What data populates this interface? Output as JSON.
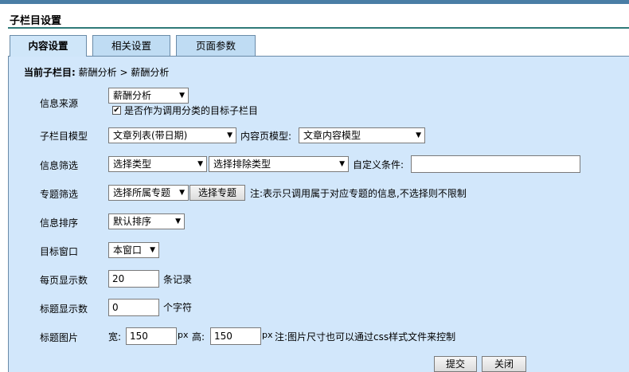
{
  "page": {
    "title": "子栏目设置"
  },
  "tabs": [
    {
      "label": "内容设置",
      "active": true
    },
    {
      "label": "相关设置",
      "active": false
    },
    {
      "label": "页面参数",
      "active": false
    }
  ],
  "breadcrumb": {
    "prefix": "当前子栏目:",
    "path": "薪酬分析 > 薪酬分析"
  },
  "form": {
    "source": {
      "label": "信息来源",
      "value": "薪酬分析",
      "checkbox_checked": true,
      "checkbox_label": "是否作为调用分类的目标子栏目"
    },
    "model": {
      "label": "子栏目模型",
      "value": "文章列表(带日期)",
      "content_label": "内容页模型:",
      "content_value": "文章内容模型"
    },
    "filter": {
      "label": "信息筛选",
      "type_value": "选择类型",
      "exclude_value": "选择排除类型",
      "custom_label": "自定义条件:",
      "custom_value": ""
    },
    "topic": {
      "label": "专题筛选",
      "select_value": "选择所属专题",
      "button_label": "选择专题",
      "note": "注:表示只调用属于对应专题的信息,不选择则不限制"
    },
    "sort": {
      "label": "信息排序",
      "value": "默认排序"
    },
    "target": {
      "label": "目标窗口",
      "value": "本窗口"
    },
    "per_page": {
      "label": "每页显示数",
      "value": "20",
      "unit": "条记录"
    },
    "title_len": {
      "label": "标题显示数",
      "value": "0",
      "unit": "个字符"
    },
    "title_img": {
      "label": "标题图片",
      "width_label": "宽:",
      "width_value": "150",
      "px1": "px",
      "height_label": "高:",
      "height_value": "150",
      "px2": "px",
      "note": "注:图片尺寸也可以通过css样式文件来控制"
    }
  },
  "buttons": {
    "submit": "提交",
    "close": "关闭"
  },
  "colors": {
    "panel_bg": "#d2e7fb",
    "tab_bg": "#bfdcf3",
    "rule": "#2f7a78",
    "topbar": "#4a7ea5"
  }
}
